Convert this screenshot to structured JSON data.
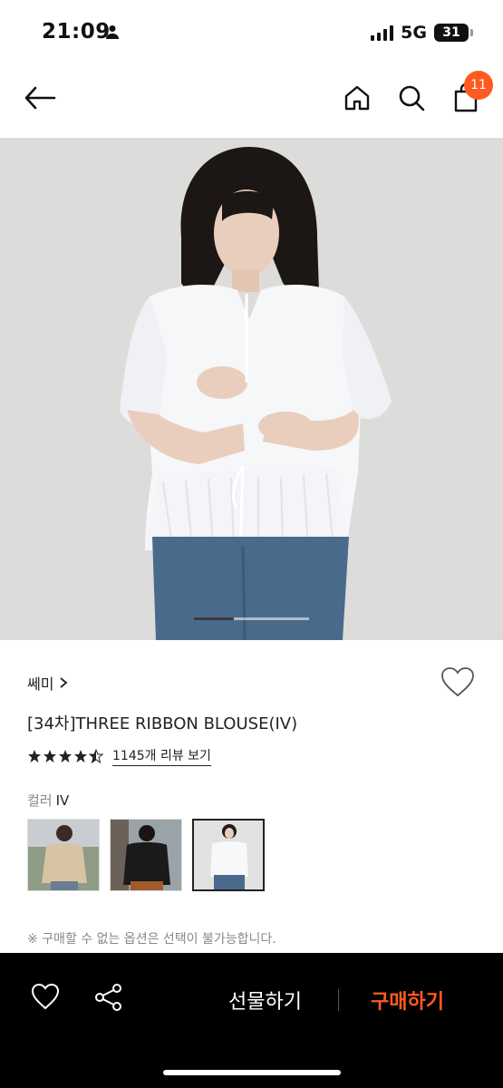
{
  "status": {
    "time": "21:09",
    "network": "5G",
    "battery": "31"
  },
  "nav": {
    "cart_count": "11"
  },
  "product": {
    "brand": "쎄미",
    "title": "[34차]THREE RIBBON BLOUSE(IV)",
    "rating": 4.5,
    "review_link": "1145개 리뷰 보기",
    "color_label": "컬러",
    "color_value": "IV",
    "swatches": [
      "beige",
      "black",
      "ivory"
    ],
    "selected_swatch": 2,
    "note": "※ 구매할 수 없는 옵션은 선택이 불가능합니다.",
    "image_index": 1,
    "image_count": 3
  },
  "actions": {
    "gift": "선물하기",
    "buy": "구매하기"
  },
  "colors": {
    "accent": "#ff5a1f",
    "bar_bg": "#000000"
  }
}
